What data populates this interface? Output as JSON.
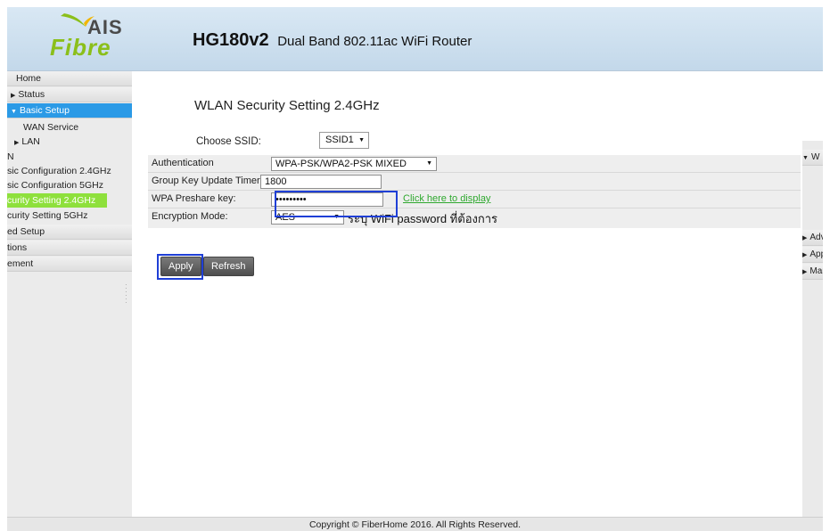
{
  "header": {
    "brand_top": "AIS",
    "brand_bottom": "Fibre",
    "model": "HG180v2",
    "model_desc": "Dual Band 802.11ac WiFi Router"
  },
  "sidebar": {
    "items": [
      {
        "label": "Home"
      },
      {
        "label": "Status"
      },
      {
        "label": "Basic Setup"
      },
      {
        "label": "WAN Service"
      },
      {
        "label": "LAN"
      },
      {
        "label": "N"
      },
      {
        "label": "sic Configuration 2.4GHz"
      },
      {
        "label": "sic Configuration 5GHz"
      },
      {
        "label": "curity Setting 2.4GHz"
      },
      {
        "label": "curity Setting 5GHz"
      },
      {
        "label": "ed Setup"
      },
      {
        "label": "tions"
      },
      {
        "label": "ement"
      }
    ]
  },
  "main": {
    "title": "WLAN Security Setting 2.4GHz",
    "ssid_label": "Choose SSID:",
    "ssid_value": "SSID1",
    "auth_label": "Authentication",
    "auth_value": "WPA-PSK/WPA2-PSK MIXED",
    "gk_label": "Group Key Update Timer:",
    "gk_value": "1800",
    "psk_label": "WPA Preshare key:",
    "psk_value": "•••••••••",
    "psk_link": "Click here to display",
    "enc_label": "Encryption Mode:",
    "enc_value": "AES",
    "hint": "ระบุ WiFi password ที่ต้องการ",
    "apply_label": "Apply",
    "refresh_label": "Refresh"
  },
  "right_sidebar": {
    "items": [
      "W",
      "Adva",
      "Appl",
      "Mana"
    ]
  },
  "footer": {
    "copyright": "Copyright © FiberHome 2016. All Rights Reserved."
  },
  "colors": {
    "active_blue": "#2b9ae6",
    "highlight_green": "#8ee03c",
    "annotation_blue": "#1f3fd6",
    "link_green": "#2ea82e"
  }
}
